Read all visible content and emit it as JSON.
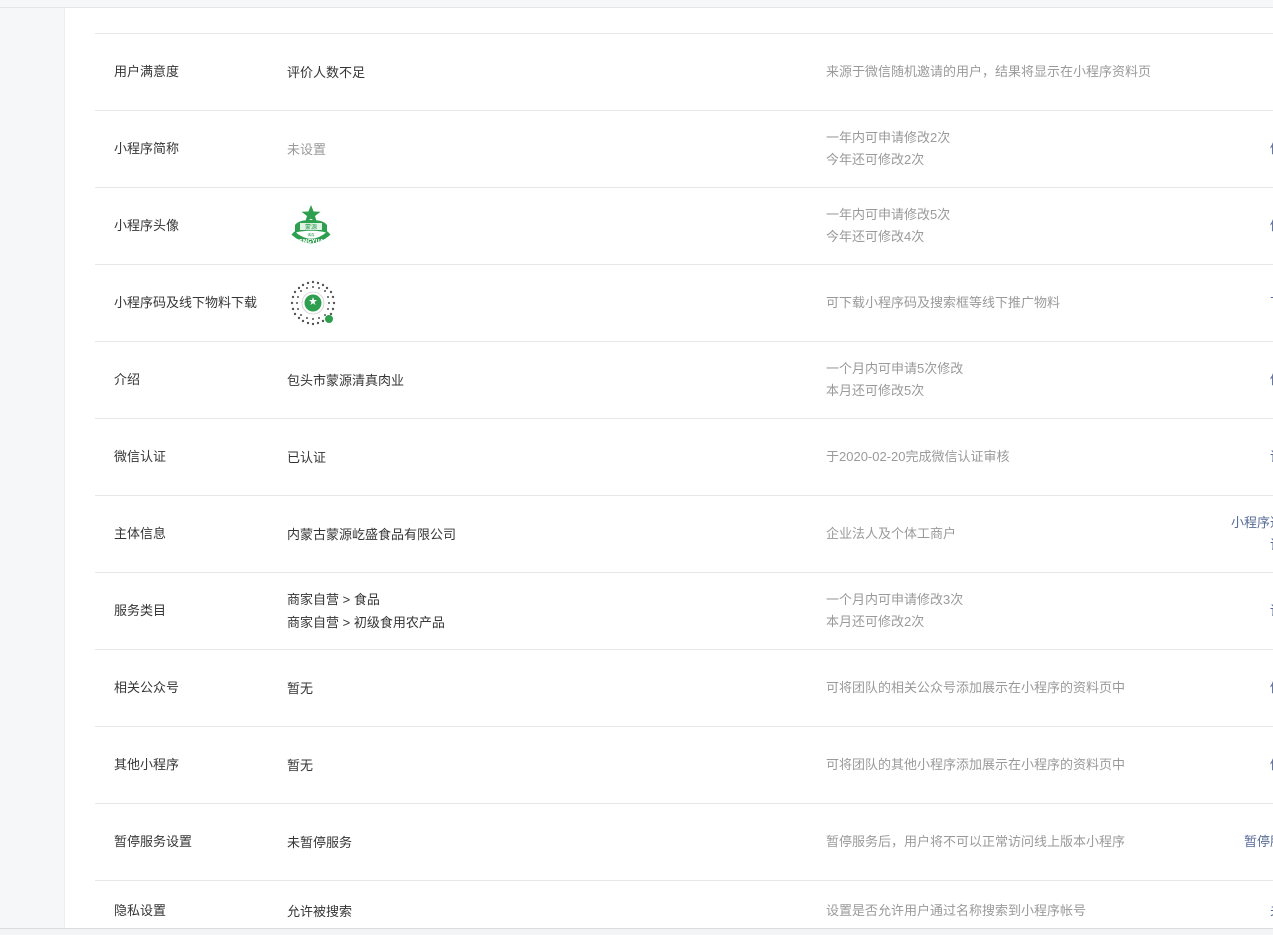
{
  "rows": [
    {
      "label": "用户满意度",
      "value": "评价人数不足",
      "desc1": "来源于微信随机邀请的用户，结果将显示在小程序资料页",
      "desc2": "",
      "action1": "",
      "action2": ""
    },
    {
      "label": "小程序简称",
      "value": "未设置",
      "desc1": "一年内可申请修改2次",
      "desc2": "今年还可修改2次",
      "action1": "修",
      "action2": ""
    },
    {
      "label": "小程序头像",
      "value": "",
      "desc1": "一年内可申请修改5次",
      "desc2": "今年还可修改4次",
      "action1": "修",
      "action2": ""
    },
    {
      "label": "小程序码及线下物料下载",
      "value": "",
      "desc1": "可下载小程序码及搜索框等线下推广物料",
      "desc2": "",
      "action1": "下",
      "action2": ""
    },
    {
      "label": "介绍",
      "value": "包头市蒙源清真肉业",
      "desc1": "一个月内可申请5次修改",
      "desc2": "本月还可修改5次",
      "action1": "修",
      "action2": ""
    },
    {
      "label": "微信认证",
      "value": "已认证",
      "desc1": "于2020-02-20完成微信认证审核",
      "desc2": "",
      "action1": "详",
      "action2": ""
    },
    {
      "label": "主体信息",
      "value": "内蒙古蒙源屹盛食品有限公司",
      "desc1": "企业法人及个体工商户",
      "desc2": "",
      "action1": "小程序迁",
      "action2": "详"
    },
    {
      "label": "服务类目",
      "value": "商家自营 > 食品",
      "value2": "商家自营 > 初级食用农产品",
      "desc1": "一个月内可申请修改3次",
      "desc2": "本月还可修改2次",
      "action1": "详",
      "action2": ""
    },
    {
      "label": "相关公众号",
      "value": "暂无",
      "desc1": "可将团队的相关公众号添加展示在小程序的资料页中",
      "desc2": "",
      "action1": "修",
      "action2": ""
    },
    {
      "label": "其他小程序",
      "value": "暂无",
      "desc1": "可将团队的其他小程序添加展示在小程序的资料页中",
      "desc2": "",
      "action1": "修",
      "action2": ""
    },
    {
      "label": "暂停服务设置",
      "value": "未暂停服务",
      "desc1": "暂停服务后，用户将不可以正常访问线上版本小程序",
      "desc2": "",
      "action1": "暂停服",
      "action2": ""
    },
    {
      "label": "隐私设置",
      "value": "允许被搜索",
      "desc1": "设置是否允许用户通过名称搜索到小程序帐号",
      "desc2": "",
      "action1": "关",
      "action2": ""
    }
  ],
  "avatar_logo": {
    "text_top": "蒙源",
    "text_brand": "MENGYUAN",
    "text_small": "清真",
    "color": "#2e9e4f"
  },
  "qr_code_icon": "mini-program-code",
  "colors": {
    "link": "#576b95",
    "desc": "#9a9a9a",
    "divider": "#e7e7eb"
  }
}
